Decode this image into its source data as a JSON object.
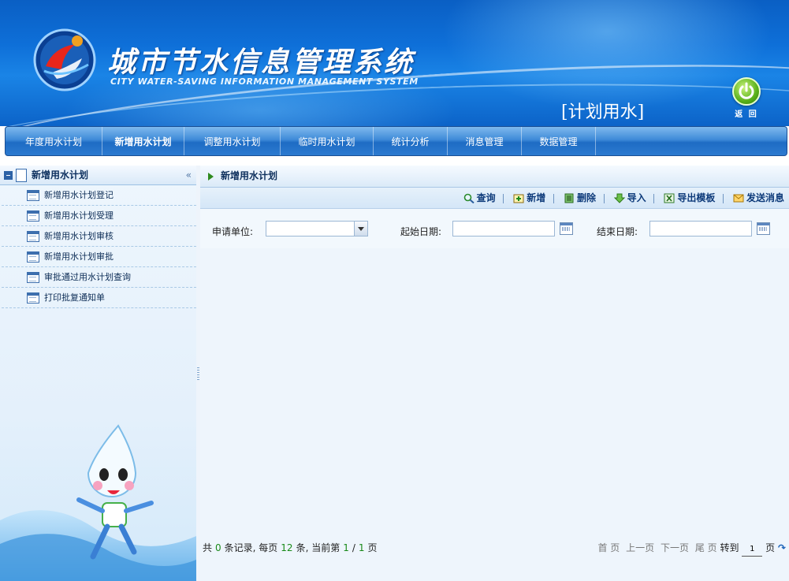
{
  "header": {
    "system_title": "城市节水信息管理系统",
    "system_subtitle": "CITY WATER-SAVING INFORMATION MANAGEMENT SYSTEM",
    "module_title": "[计划用水]",
    "back_label": "返 回"
  },
  "nav": {
    "tabs": [
      {
        "label": "年度用水计划"
      },
      {
        "label": "新增用水计划",
        "active": true
      },
      {
        "label": "调整用水计划"
      },
      {
        "label": "临时用水计划"
      },
      {
        "label": "统计分析"
      },
      {
        "label": "消息管理"
      },
      {
        "label": "数据管理"
      }
    ]
  },
  "sidebar": {
    "title": "新增用水计划",
    "collapse": "«",
    "items": [
      {
        "label": "新增用水计划登记"
      },
      {
        "label": "新增用水计划受理"
      },
      {
        "label": "新增用水计划审核"
      },
      {
        "label": "新增用水计划审批"
      },
      {
        "label": "审批通过用水计划查询"
      },
      {
        "label": "打印批复通知单"
      }
    ]
  },
  "main": {
    "title": "新增用水计划",
    "toolbar": {
      "query": "查询",
      "add": "新增",
      "delete": "删除",
      "import": "导入",
      "export_template": "导出模板",
      "send_message": "发送消息"
    },
    "filters": {
      "unit_label": "申请单位:",
      "start_label": "起始日期:",
      "end_label": "结束日期:"
    }
  },
  "pager": {
    "prefix": "共",
    "total_records": "0",
    "per_page_text": "条记录, 每页",
    "per_page": "12",
    "current_text": "条, 当前第",
    "current_page": "1",
    "slash": "/",
    "total_pages": "1",
    "page_suffix": "页",
    "first": "首  页",
    "prev": "上一页",
    "next": "下一页",
    "last": "尾  页",
    "goto_label": "转到",
    "goto_value": "1",
    "goto_suffix": "页"
  },
  "colors": {
    "header_blue": "#0e6fd8",
    "nav_blue": "#2c7ad0",
    "panel_bg": "#eef5fc",
    "pager_number": "#1a8a1a",
    "back_green": "#5ab11a"
  }
}
